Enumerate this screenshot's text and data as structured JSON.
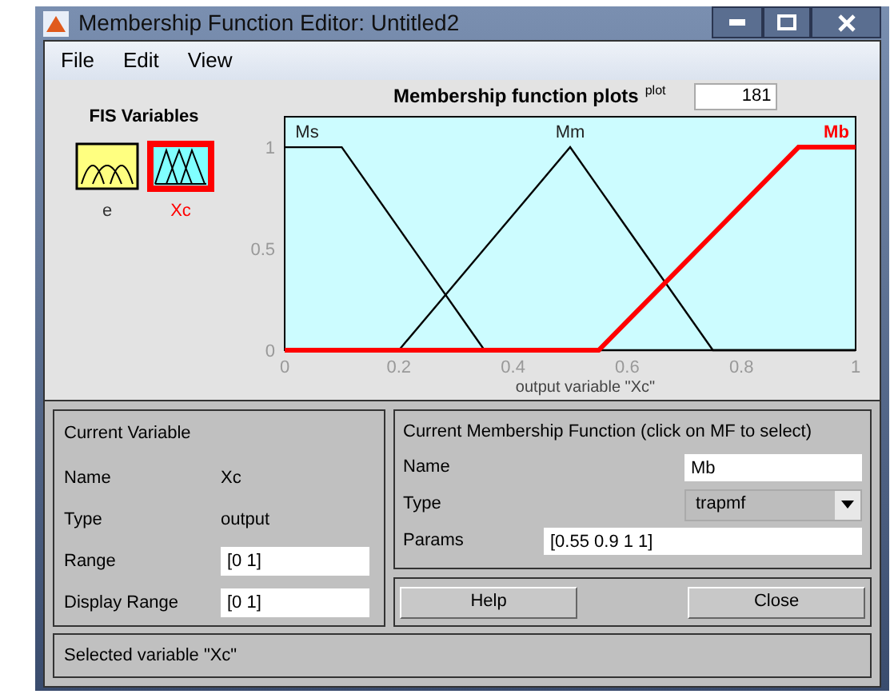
{
  "window": {
    "title": "Membership Function Editor: Untitled2"
  },
  "menu": [
    "File",
    "Edit",
    "View"
  ],
  "fis_variables": {
    "title": "FIS Variables",
    "items": [
      {
        "name": "e",
        "kind": "input",
        "selected": false
      },
      {
        "name": "Xc",
        "kind": "output",
        "selected": true
      }
    ]
  },
  "plot": {
    "title": "Membership function plots",
    "points_label": "plot",
    "points": "181",
    "chart_data": {
      "type": "line",
      "xlabel": "output variable \"Xc\"",
      "x": [
        0,
        0.1,
        0.2,
        0.35,
        0.5,
        0.55,
        0.75,
        0.9,
        1
      ],
      "xlim": [
        0,
        1
      ],
      "ylim": [
        0,
        1.15
      ],
      "xticks": [
        0,
        0.2,
        0.4,
        0.6,
        0.8,
        1
      ],
      "yticks": [
        0,
        0.5,
        1
      ],
      "series": [
        {
          "name": "Ms",
          "color": "#000000",
          "values": [
            1,
            1,
            0.6,
            0,
            0,
            0,
            0,
            0,
            0
          ]
        },
        {
          "name": "Mm",
          "color": "#000000",
          "values": [
            0,
            0,
            0,
            0.5,
            1,
            0.8,
            0,
            0,
            0
          ]
        },
        {
          "name": "Mb",
          "color": "#ff0000",
          "values": [
            0,
            0,
            0,
            0,
            0,
            0,
            0.571,
            1,
            1
          ]
        }
      ]
    }
  },
  "current_variable": {
    "title": "Current Variable",
    "fields": [
      {
        "label": "Name",
        "value": "Xc",
        "kind": "text"
      },
      {
        "label": "Type",
        "value": "output",
        "kind": "text"
      },
      {
        "label": "Range",
        "value": "[0 1]",
        "kind": "input"
      },
      {
        "label": "Display Range",
        "value": "[0 1]",
        "kind": "input"
      }
    ]
  },
  "current_mf": {
    "title": "Current Membership Function (click on MF to select)",
    "name_label": "Name",
    "name": "Mb",
    "type_label": "Type",
    "type": "trapmf",
    "params_label": "Params",
    "params": "[0.55 0.9 1 1]"
  },
  "buttons": [
    "Help",
    "Close"
  ],
  "status": "Selected variable \"Xc\""
}
